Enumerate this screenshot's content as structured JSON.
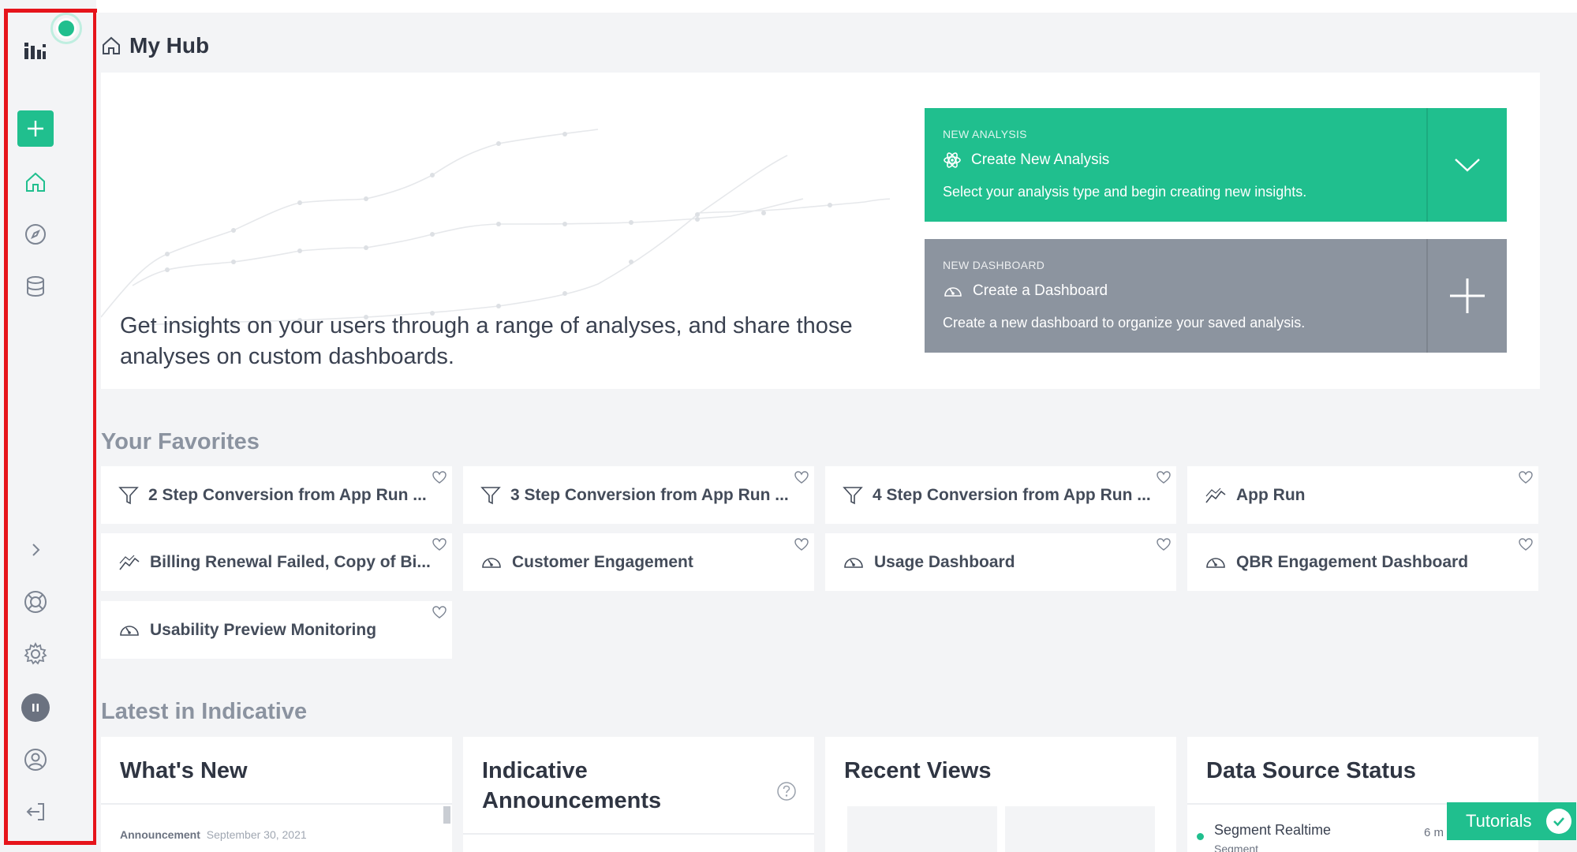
{
  "page": {
    "title": "My Hub"
  },
  "hero": {
    "text": "Get insights on your users through a range of analyses, and share those analyses on custom dashboards."
  },
  "actions": {
    "new_analysis": {
      "kicker": "NEW ANALYSIS",
      "title": "Create New Analysis",
      "desc": "Select your analysis type and begin creating new insights."
    },
    "new_dashboard": {
      "kicker": "NEW DASHBOARD",
      "title": "Create a Dashboard",
      "desc": "Create a new dashboard to organize your saved analysis."
    }
  },
  "favorites": {
    "title": "Your Favorites",
    "items": [
      {
        "label": "2 Step Conversion from App Run ...",
        "icon": "funnel-icon"
      },
      {
        "label": "3 Step Conversion from App Run ...",
        "icon": "funnel-icon"
      },
      {
        "label": "4 Step Conversion from App Run ...",
        "icon": "funnel-icon"
      },
      {
        "label": "App Run",
        "icon": "trend-icon"
      },
      {
        "label": "Billing Renewal Failed, Copy of Bi...",
        "icon": "trend-icon"
      },
      {
        "label": "Customer Engagement",
        "icon": "dashboard-icon"
      },
      {
        "label": "Usage Dashboard",
        "icon": "dashboard-icon"
      },
      {
        "label": "QBR Engagement Dashboard",
        "icon": "dashboard-icon"
      },
      {
        "label": "Usability Preview Monitoring",
        "icon": "dashboard-icon"
      }
    ]
  },
  "latest": {
    "title": "Latest in Indicative",
    "whats_new": {
      "title": "What's New",
      "tag": "Announcement",
      "date": "September 30, 2021"
    },
    "announcements": {
      "title_line1": "Indicative",
      "title_line2": "Announcements"
    },
    "recent_views": {
      "title": "Recent Views"
    },
    "data_source": {
      "title": "Data Source Status",
      "source_name": "Segment Realtime",
      "source_type": "Segment",
      "time": "6 m"
    }
  },
  "tutorials": {
    "label": "Tutorials"
  },
  "colors": {
    "accent": "#20bf8e",
    "gray_card": "#8c949f",
    "highlight": "#e6141b"
  }
}
